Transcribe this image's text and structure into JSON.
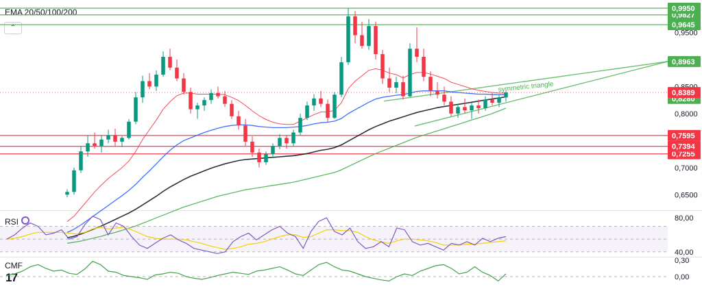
{
  "panes": {
    "main_title": "EMA 20/50/100/200",
    "rsi_title": "RSI",
    "cmf_title": "CMF",
    "collapse_icon": "chevron-up-icon",
    "logo_text": "17"
  },
  "colors": {
    "background": "#ffffff",
    "candle_up": "#089981",
    "candle_down": "#f23645",
    "ema20": "#f23645",
    "ema50": "#2962ff",
    "ema100": "#131722",
    "ema200": "#4caf50",
    "resistance": "#4caf50",
    "support": "#f23645",
    "rsi": "#7e57c2",
    "rsi_ma": "#f5d000",
    "cmf": "#43a047"
  },
  "chart_data": [
    {
      "type": "candlestick",
      "title": "EMA 20/50/100/200",
      "ylim": [
        0.625,
        1.0
      ],
      "y_ticks": [
        "0,9500",
        "0,8500",
        "0,8000",
        "0,7000",
        "0,6500"
      ],
      "current_price": 0.8389,
      "price_label": "0,8389",
      "ohlc": [
        [
          0.65,
          0.66,
          0.645,
          0.655
        ],
        [
          0.655,
          0.7,
          0.65,
          0.695
        ],
        [
          0.695,
          0.74,
          0.69,
          0.73
        ],
        [
          0.73,
          0.76,
          0.72,
          0.745
        ],
        [
          0.745,
          0.765,
          0.735,
          0.74
        ],
        [
          0.74,
          0.76,
          0.728,
          0.752
        ],
        [
          0.752,
          0.77,
          0.745,
          0.76
        ],
        [
          0.76,
          0.772,
          0.74,
          0.748
        ],
        [
          0.748,
          0.758,
          0.738,
          0.755
        ],
        [
          0.755,
          0.79,
          0.752,
          0.785
        ],
        [
          0.785,
          0.84,
          0.78,
          0.83
        ],
        [
          0.83,
          0.87,
          0.82,
          0.86
        ],
        [
          0.86,
          0.875,
          0.845,
          0.85
        ],
        [
          0.85,
          0.88,
          0.842,
          0.872
        ],
        [
          0.872,
          0.915,
          0.868,
          0.905
        ],
        [
          0.905,
          0.92,
          0.88,
          0.885
        ],
        [
          0.885,
          0.9,
          0.86,
          0.865
        ],
        [
          0.865,
          0.875,
          0.835,
          0.84
        ],
        [
          0.84,
          0.848,
          0.8,
          0.808
        ],
        [
          0.808,
          0.82,
          0.79,
          0.815
        ],
        [
          0.815,
          0.83,
          0.805,
          0.825
        ],
        [
          0.825,
          0.845,
          0.818,
          0.838
        ],
        [
          0.838,
          0.85,
          0.828,
          0.832
        ],
        [
          0.832,
          0.842,
          0.812,
          0.818
        ],
        [
          0.818,
          0.825,
          0.79,
          0.795
        ],
        [
          0.795,
          0.805,
          0.77,
          0.778
        ],
        [
          0.778,
          0.79,
          0.74,
          0.748
        ],
        [
          0.748,
          0.758,
          0.72,
          0.728
        ],
        [
          0.728,
          0.735,
          0.7,
          0.71
        ],
        [
          0.71,
          0.73,
          0.705,
          0.725
        ],
        [
          0.725,
          0.745,
          0.718,
          0.74
        ],
        [
          0.74,
          0.762,
          0.734,
          0.755
        ],
        [
          0.755,
          0.76,
          0.735,
          0.745
        ],
        [
          0.745,
          0.77,
          0.74,
          0.765
        ],
        [
          0.765,
          0.8,
          0.76,
          0.792
        ],
        [
          0.792,
          0.822,
          0.788,
          0.815
        ],
        [
          0.815,
          0.836,
          0.805,
          0.828
        ],
        [
          0.828,
          0.842,
          0.812,
          0.818
        ],
        [
          0.818,
          0.826,
          0.784,
          0.792
        ],
        [
          0.792,
          0.84,
          0.79,
          0.835
        ],
        [
          0.835,
          0.905,
          0.83,
          0.895
        ],
        [
          0.895,
          0.995,
          0.89,
          0.98
        ],
        [
          0.98,
          0.99,
          0.93,
          0.945
        ],
        [
          0.945,
          0.97,
          0.92,
          0.925
        ],
        [
          0.925,
          0.975,
          0.918,
          0.962
        ],
        [
          0.962,
          0.97,
          0.9,
          0.91
        ],
        [
          0.91,
          0.918,
          0.855,
          0.865
        ],
        [
          0.865,
          0.885,
          0.84,
          0.848
        ],
        [
          0.848,
          0.868,
          0.838,
          0.858
        ],
        [
          0.858,
          0.87,
          0.826,
          0.832
        ],
        [
          0.832,
          0.93,
          0.83,
          0.92
        ],
        [
          0.92,
          0.96,
          0.895,
          0.905
        ],
        [
          0.905,
          0.92,
          0.86,
          0.868
        ],
        [
          0.868,
          0.878,
          0.832,
          0.842
        ],
        [
          0.842,
          0.858,
          0.828,
          0.835
        ],
        [
          0.835,
          0.85,
          0.815,
          0.822
        ],
        [
          0.822,
          0.832,
          0.795,
          0.8
        ],
        [
          0.8,
          0.818,
          0.792,
          0.812
        ],
        [
          0.812,
          0.828,
          0.8,
          0.806
        ],
        [
          0.806,
          0.82,
          0.79,
          0.815
        ],
        [
          0.815,
          0.826,
          0.8,
          0.81
        ],
        [
          0.81,
          0.832,
          0.805,
          0.826
        ],
        [
          0.826,
          0.838,
          0.815,
          0.82
        ],
        [
          0.82,
          0.834,
          0.812,
          0.83
        ],
        [
          0.83,
          0.845,
          0.822,
          0.839
        ]
      ],
      "series": [
        {
          "values": [
            0.6,
            0.61,
            0.625,
            0.64,
            0.655,
            0.668,
            0.68,
            0.69,
            0.7,
            0.712,
            0.73,
            0.752,
            0.77,
            0.788,
            0.808,
            0.822,
            0.833,
            0.838,
            0.838,
            0.836,
            0.836,
            0.836,
            0.836,
            0.835,
            0.83,
            0.824,
            0.815,
            0.805,
            0.796,
            0.789,
            0.784,
            0.781,
            0.78,
            0.78,
            0.786,
            0.792,
            0.798,
            0.803,
            0.803,
            0.806,
            0.82,
            0.846,
            0.86,
            0.87,
            0.88,
            0.883,
            0.88,
            0.875,
            0.872,
            0.866,
            0.872,
            0.876,
            0.876,
            0.873,
            0.869,
            0.865,
            0.858,
            0.854,
            0.85,
            0.846,
            0.843,
            0.841,
            0.839,
            0.838,
            0.838
          ]
        },
        {
          "values": [
            0.58,
            0.586,
            0.594,
            0.603,
            0.612,
            0.621,
            0.63,
            0.639,
            0.648,
            0.658,
            0.669,
            0.682,
            0.694,
            0.707,
            0.72,
            0.732,
            0.742,
            0.75,
            0.755,
            0.76,
            0.765,
            0.769,
            0.773,
            0.776,
            0.778,
            0.779,
            0.779,
            0.778,
            0.776,
            0.775,
            0.774,
            0.774,
            0.774,
            0.775,
            0.776,
            0.778,
            0.781,
            0.783,
            0.784,
            0.786,
            0.791,
            0.8,
            0.807,
            0.814,
            0.821,
            0.827,
            0.83,
            0.832,
            0.834,
            0.835,
            0.838,
            0.841,
            0.842,
            0.842,
            0.842,
            0.842,
            0.84,
            0.839,
            0.838,
            0.837,
            0.836,
            0.836,
            0.835,
            0.835,
            0.835
          ]
        },
        {
          "values": [
            0.57,
            0.573,
            0.577,
            0.582,
            0.587,
            0.592,
            0.598,
            0.604,
            0.61,
            0.616,
            0.623,
            0.631,
            0.639,
            0.647,
            0.656,
            0.664,
            0.671,
            0.678,
            0.684,
            0.689,
            0.694,
            0.699,
            0.703,
            0.707,
            0.71,
            0.713,
            0.715,
            0.716,
            0.717,
            0.718,
            0.719,
            0.72,
            0.721,
            0.722,
            0.724,
            0.726,
            0.729,
            0.732,
            0.734,
            0.737,
            0.742,
            0.749,
            0.756,
            0.763,
            0.77,
            0.776,
            0.781,
            0.786,
            0.79,
            0.794,
            0.798,
            0.802,
            0.805,
            0.808,
            0.811,
            0.813,
            0.815,
            0.817,
            0.819,
            0.821,
            0.823,
            0.825,
            0.827,
            0.829,
            0.831
          ]
        },
        {
          "values": [
            0.56,
            0.562,
            0.564,
            0.567,
            0.57,
            0.573,
            0.577,
            0.58,
            0.584,
            0.588,
            0.592,
            0.597,
            0.602,
            0.607,
            0.612,
            0.617,
            0.622,
            0.627,
            0.631,
            0.635,
            0.639,
            0.643,
            0.647,
            0.65,
            0.653,
            0.656,
            0.659,
            0.661,
            0.663,
            0.665,
            0.667,
            0.669,
            0.671,
            0.673,
            0.676,
            0.679,
            0.682,
            0.685,
            0.688,
            0.691,
            0.696,
            0.702,
            0.708,
            0.714,
            0.72,
            0.726,
            0.731,
            0.736,
            0.741,
            0.746,
            0.751,
            0.756,
            0.76,
            0.764,
            0.768,
            0.772,
            0.776,
            0.78,
            0.784,
            0.788,
            0.792,
            0.796,
            0.8,
            0.805,
            0.81
          ]
        }
      ],
      "horizontal_levels": [
        {
          "value": 0.995,
          "label": "0,9950",
          "kind": "resistance"
        },
        {
          "value": 0.9827,
          "label": "0,9827",
          "kind": "resistance"
        },
        {
          "value": 0.9645,
          "label": "0,9645",
          "kind": "resistance"
        },
        {
          "value": 0.7595,
          "label": "0,7595",
          "kind": "support"
        },
        {
          "value": 0.7394,
          "label": "0,7394",
          "kind": "support"
        },
        {
          "value": 0.7255,
          "label": "0,7255",
          "kind": "support"
        }
      ],
      "extra_labels": [
        {
          "value": 0.8963,
          "label": "0,8963",
          "kind": "resistance"
        },
        {
          "value": 0.828,
          "label": "0,8280",
          "kind": "resistance"
        }
      ],
      "annotations": [
        {
          "text": "symmetric triangle",
          "upper_line": [
            [
              0.828,
              0.8963
            ]
          ],
          "lower_line": [
            [
              0.7595,
              0.8963
            ]
          ]
        }
      ]
    },
    {
      "type": "line",
      "title": "RSI",
      "ylim": [
        35,
        85
      ],
      "y_ticks": [
        "80,00",
        "40,00"
      ],
      "band": [
        40,
        70
      ],
      "series": [
        {
          "values": [
            55,
            60,
            68,
            74,
            70,
            60,
            62,
            66,
            55,
            58,
            72,
            82,
            78,
            60,
            74,
            70,
            58,
            48,
            44,
            50,
            56,
            60,
            54,
            50,
            44,
            42,
            40,
            38,
            40,
            52,
            58,
            62,
            54,
            60,
            66,
            70,
            62,
            58,
            44,
            64,
            76,
            80,
            64,
            60,
            68,
            52,
            44,
            46,
            52,
            46,
            68,
            66,
            52,
            48,
            50,
            46,
            42,
            50,
            48,
            52,
            48,
            56,
            52,
            56,
            58
          ]
        },
        {
          "values": [
            55,
            56,
            58,
            61,
            63,
            63,
            63,
            63,
            62,
            61,
            63,
            67,
            69,
            67,
            68,
            69,
            66,
            62,
            58,
            56,
            55,
            55,
            55,
            54,
            52,
            50,
            47,
            45,
            43,
            44,
            46,
            49,
            50,
            52,
            55,
            58,
            60,
            60,
            57,
            58,
            62,
            66,
            66,
            65,
            65,
            63,
            58,
            54,
            52,
            50,
            53,
            55,
            55,
            54,
            53,
            51,
            48,
            48,
            48,
            49,
            49,
            50,
            51,
            52,
            53
          ]
        }
      ]
    },
    {
      "type": "line",
      "title": "CMF",
      "ylim": [
        -0.2,
        0.35
      ],
      "y_ticks": [
        "0,30",
        "0,00"
      ],
      "series": [
        {
          "values": [
            0.02,
            0.05,
            0.1,
            0.18,
            0.22,
            0.15,
            0.1,
            0.12,
            0.06,
            0.04,
            0.14,
            0.28,
            0.22,
            0.1,
            0.08,
            0.02,
            0.0,
            -0.02,
            -0.05,
            0.03,
            0.05,
            0.08,
            0.06,
            0.0,
            -0.03,
            -0.05,
            -0.02,
            0.02,
            0.05,
            0.08,
            0.06,
            0.04,
            0.1,
            0.12,
            0.15,
            0.18,
            0.12,
            0.05,
            0.02,
            0.12,
            0.22,
            0.26,
            0.18,
            0.12,
            0.1,
            0.05,
            0.0,
            -0.03,
            -0.06,
            -0.08,
            0.0,
            0.05,
            0.02,
            0.1,
            0.15,
            0.2,
            0.22,
            0.15,
            0.05,
            0.08,
            0.18,
            0.08,
            0.02,
            -0.08,
            0.05
          ]
        }
      ]
    }
  ]
}
